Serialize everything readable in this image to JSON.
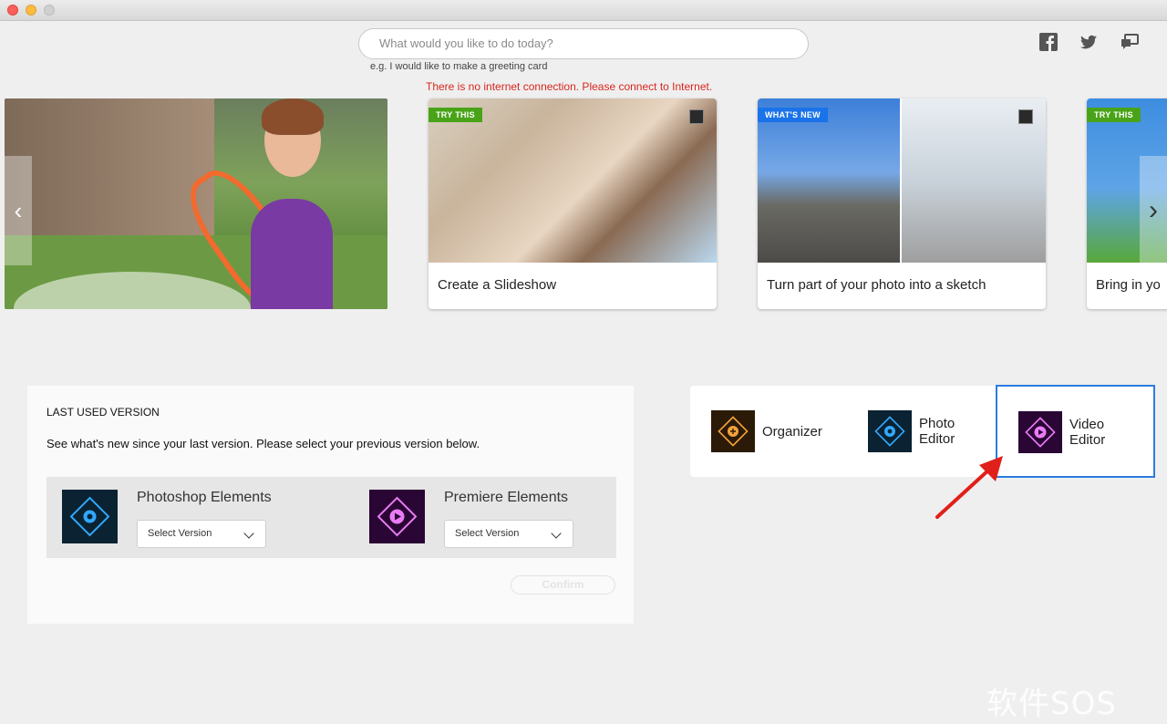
{
  "window": {
    "controls": [
      "close",
      "minimize",
      "zoom"
    ]
  },
  "search": {
    "placeholder": "What would you like to do today?",
    "hint": "e.g. I would like to make a greeting card"
  },
  "alert": {
    "no_internet": "There is no internet connection. Please connect to Internet."
  },
  "social": {
    "icons": [
      "facebook-icon",
      "twitter-icon",
      "feedback-icon"
    ]
  },
  "carousel": {
    "cards": [
      {
        "badge": "TRY THIS",
        "caption": "Create a Slideshow"
      },
      {
        "badge": "WHAT'S NEW",
        "caption": "Turn part of your photo into a sketch"
      },
      {
        "badge": "TRY THIS",
        "caption": "Bring in yo"
      }
    ]
  },
  "last_used": {
    "title": "LAST USED VERSION",
    "description": "See what's new since your last version. Please select your previous version below.",
    "products": [
      {
        "name": "Photoshop Elements",
        "select": "Select Version"
      },
      {
        "name": "Premiere Elements",
        "select": "Select Version"
      }
    ],
    "confirm": "Confirm"
  },
  "apps": {
    "organizer": "Organizer",
    "photo_line1": "Photo",
    "photo_line2": "Editor",
    "video_line1": "Video",
    "video_line2": "Editor"
  },
  "watermark": "软件SOS",
  "colors": {
    "alert": "#d7261e",
    "badge_green": "#49a318",
    "badge_blue": "#1a73e8",
    "selected_border": "#2b7ce0",
    "annotation_arrow": "#e0201a"
  }
}
